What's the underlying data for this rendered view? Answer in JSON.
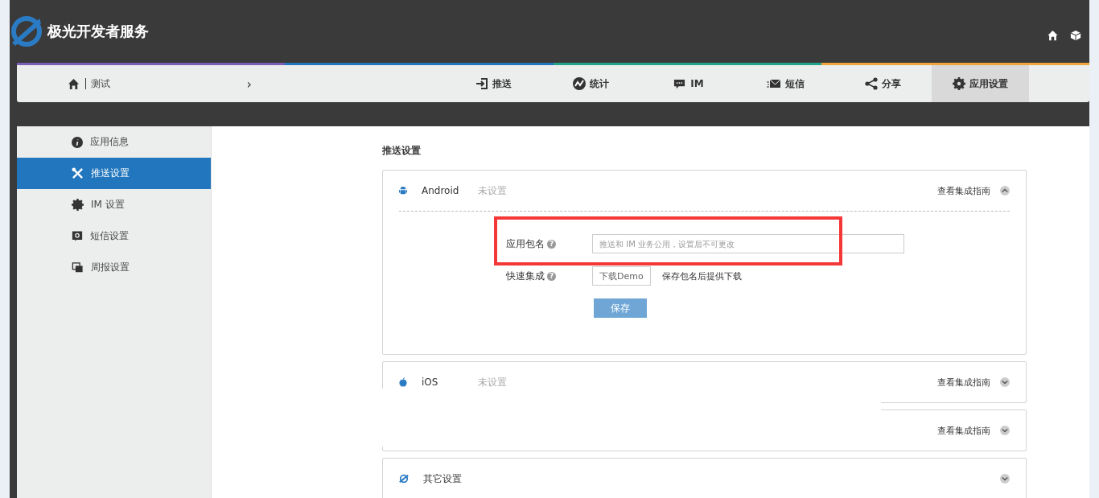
{
  "header": {
    "brand": "极光开发者服务"
  },
  "breadcrumb": {
    "app": "测试",
    "chevron": "›"
  },
  "nav_tabs": [
    {
      "label": "推送",
      "selected": false
    },
    {
      "label": "统计",
      "selected": false
    },
    {
      "label": "IM",
      "selected": false
    },
    {
      "label": "短信",
      "selected": false
    },
    {
      "label": "分享",
      "selected": false
    },
    {
      "label": "应用设置",
      "selected": true
    }
  ],
  "sidebar": {
    "items": [
      {
        "label": "应用信息",
        "selected": false
      },
      {
        "label": "推送设置",
        "selected": true
      },
      {
        "label": "IM 设置",
        "selected": false
      },
      {
        "label": "短信设置",
        "selected": false
      },
      {
        "label": "周报设置",
        "selected": false
      }
    ]
  },
  "section_title": "推送设置",
  "panels": [
    {
      "kind": "android",
      "name": "Android",
      "status": "未设置",
      "guide": "查看集成指南",
      "expanded": true,
      "form": {
        "help_mark": "?",
        "package_label": "应用包名",
        "package_placeholder": "推送和 IM 业务公用，设置后不可更改",
        "quick_label": "快速集成",
        "download_button": "下载Demo",
        "download_note": "保存包名后提供下载",
        "save_button": "保存"
      }
    },
    {
      "kind": "ios",
      "name": "iOS",
      "status": "未设置",
      "guide": "查看集成指南",
      "expanded": false
    },
    {
      "kind": "blank",
      "guide": "查看集成指南",
      "expanded": false
    },
    {
      "kind": "other",
      "name": "其它设置",
      "expanded": false
    }
  ]
}
